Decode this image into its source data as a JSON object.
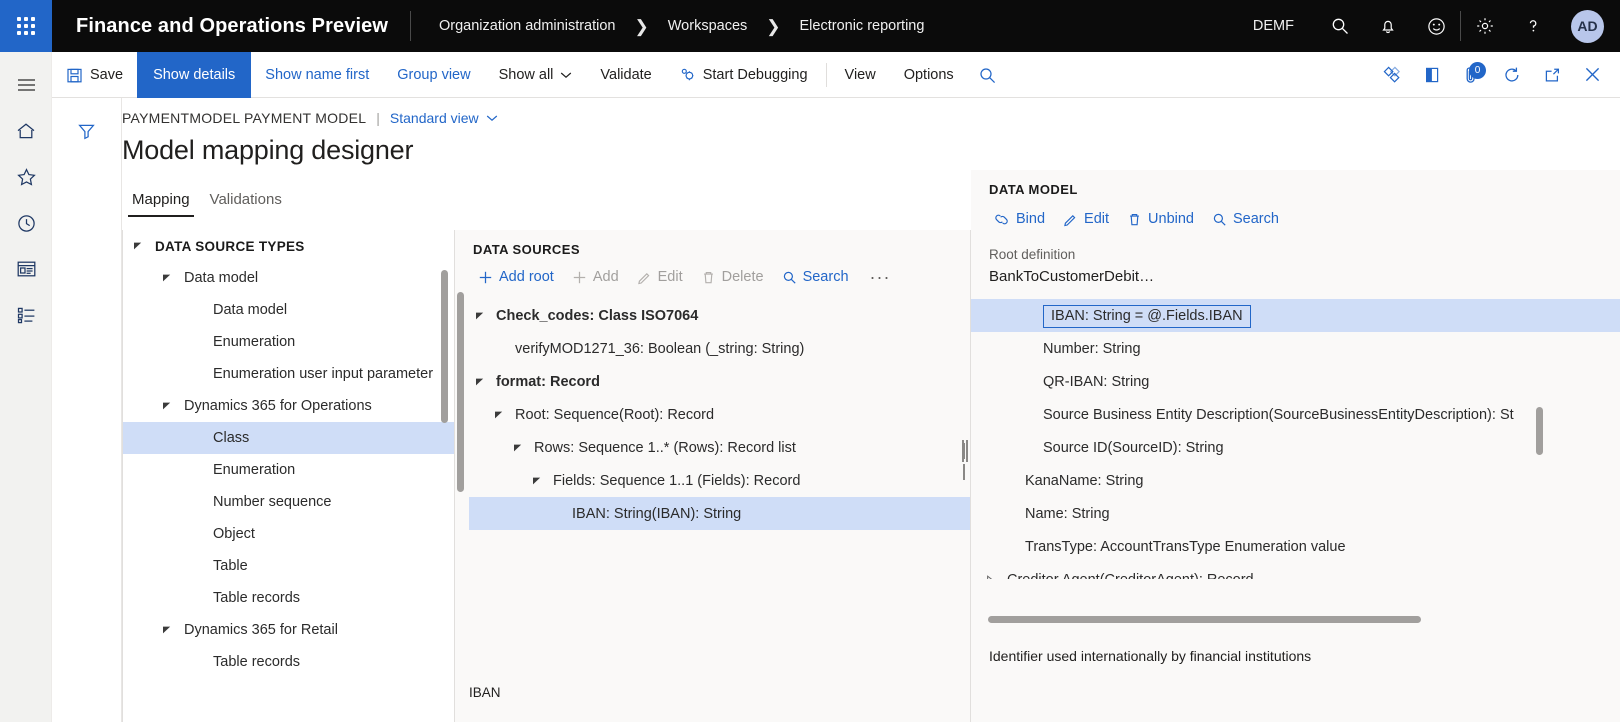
{
  "topbar": {
    "waffle_label": "App launcher",
    "brand": "Finance and Operations Preview",
    "breadcrumb": [
      "Organization administration",
      "Workspaces",
      "Electronic reporting"
    ],
    "company": "DEMF",
    "icons": [
      "search-icon",
      "bell-icon",
      "smiley-icon",
      "gear-icon",
      "help-icon"
    ],
    "avatar_initials": "AD"
  },
  "rail": {
    "items": [
      "hamburger-icon",
      "home-icon",
      "star-icon",
      "clock-icon",
      "workspace-icon",
      "module-list-icon"
    ]
  },
  "actionpane": {
    "save_label": "Save",
    "tabs": [
      {
        "label": "Show details",
        "selected": true
      },
      {
        "label": "Show name first",
        "selected": false
      },
      {
        "label": "Group view",
        "selected": false
      },
      {
        "label": "Show all",
        "selected": false,
        "caret": true
      },
      {
        "label": "Validate",
        "selected": false
      },
      {
        "label": "Start Debugging",
        "selected": false,
        "icon": "debug-icon"
      }
    ],
    "right_menus": [
      "View",
      "Options"
    ],
    "search_icon": "search-icon",
    "right_icons": [
      "diamond-icon",
      "open-in-icon",
      "attachment-icon",
      "refresh-icon",
      "popout-icon",
      "close-icon"
    ],
    "attachment_badge": "0"
  },
  "filter": {
    "icon": "filter-icon"
  },
  "pagehead": {
    "caption": "PAYMENTMODEL PAYMENT MODEL",
    "separator": "|",
    "view": "Standard view",
    "title": "Model mapping designer"
  },
  "tabs": [
    {
      "label": "Mapping",
      "active": true
    },
    {
      "label": "Validations",
      "active": false
    }
  ],
  "panel_types": {
    "title": "DATA SOURCE TYPES",
    "rows": [
      {
        "label": "DATA SOURCE TYPES",
        "indent": 0,
        "toggle": "expanded",
        "header": true,
        "selected": false
      },
      {
        "label": "Data model",
        "indent": 1,
        "toggle": "expanded",
        "header": false,
        "selected": false
      },
      {
        "label": "Data model",
        "indent": 2,
        "toggle": "none",
        "header": false,
        "selected": false
      },
      {
        "label": "Enumeration",
        "indent": 2,
        "toggle": "none",
        "header": false,
        "selected": false
      },
      {
        "label": "Enumeration user input parameter",
        "indent": 2,
        "toggle": "none",
        "header": false,
        "selected": false
      },
      {
        "label": "Dynamics 365 for Operations",
        "indent": 1,
        "toggle": "expanded",
        "header": false,
        "selected": false
      },
      {
        "label": "Class",
        "indent": 2,
        "toggle": "none",
        "header": false,
        "selected": true
      },
      {
        "label": "Enumeration",
        "indent": 2,
        "toggle": "none",
        "header": false,
        "selected": false
      },
      {
        "label": "Number sequence",
        "indent": 2,
        "toggle": "none",
        "header": false,
        "selected": false
      },
      {
        "label": "Object",
        "indent": 2,
        "toggle": "none",
        "header": false,
        "selected": false
      },
      {
        "label": "Table",
        "indent": 2,
        "toggle": "none",
        "header": false,
        "selected": false
      },
      {
        "label": "Table records",
        "indent": 2,
        "toggle": "none",
        "header": false,
        "selected": false
      },
      {
        "label": "Dynamics 365 for Retail",
        "indent": 1,
        "toggle": "expanded",
        "header": false,
        "selected": false
      },
      {
        "label": "Table records",
        "indent": 2,
        "toggle": "none",
        "header": false,
        "selected": false
      }
    ]
  },
  "panel_sources": {
    "title": "DATA SOURCES",
    "toolbar": [
      {
        "label": "Add root",
        "icon": "plus-icon",
        "disabled": false
      },
      {
        "label": "Add",
        "icon": "plus-icon",
        "disabled": true
      },
      {
        "label": "Edit",
        "icon": "pencil-icon",
        "disabled": true
      },
      {
        "label": "Delete",
        "icon": "trash-icon",
        "disabled": true
      },
      {
        "label": "Search",
        "icon": "search-icon",
        "disabled": false
      }
    ],
    "overflow": "···",
    "rows": [
      {
        "label": "Check_codes: Class ISO7064",
        "indent": 0,
        "toggle": "expanded",
        "bold": true,
        "selected": false
      },
      {
        "label": "verifyMOD1271_36: Boolean (_string: String)",
        "indent": 1,
        "toggle": "none",
        "bold": false,
        "selected": false
      },
      {
        "label": "format: Record",
        "indent": 0,
        "toggle": "expanded",
        "bold": true,
        "selected": false
      },
      {
        "label": "Root: Sequence(Root): Record",
        "indent": 1,
        "toggle": "expanded",
        "bold": false,
        "selected": false
      },
      {
        "label": "Rows: Sequence 1..* (Rows): Record list",
        "indent": 2,
        "toggle": "expanded",
        "bold": false,
        "selected": false
      },
      {
        "label": "Fields: Sequence 1..1 (Fields): Record",
        "indent": 3,
        "toggle": "expanded",
        "bold": false,
        "selected": false
      },
      {
        "label": "IBAN: String(IBAN): String",
        "indent": 4,
        "toggle": "none",
        "bold": false,
        "selected": true
      }
    ],
    "footer": "IBAN"
  },
  "panel_model": {
    "title": "DATA MODEL",
    "toolbar": [
      {
        "label": "Bind",
        "icon": "bind-icon"
      },
      {
        "label": "Edit",
        "icon": "pencil-icon"
      },
      {
        "label": "Unbind",
        "icon": "trash-icon"
      },
      {
        "label": "Search",
        "icon": "search-icon"
      }
    ],
    "root_definition_label": "Root definition",
    "root_definition_value": "BankToCustomerDebit…",
    "rows": [
      {
        "label": "IBAN: String = @.Fields.IBAN",
        "indent": 2,
        "toggle": "none",
        "selected": true,
        "chip": true
      },
      {
        "label": "Number: String",
        "indent": 2,
        "toggle": "none",
        "selected": false,
        "chip": false
      },
      {
        "label": "QR-IBAN: String",
        "indent": 2,
        "toggle": "none",
        "selected": false,
        "chip": false
      },
      {
        "label": "Source Business Entity Description(SourceBusinessEntityDescription): St",
        "indent": 2,
        "toggle": "none",
        "selected": false,
        "chip": false
      },
      {
        "label": "Source ID(SourceID): String",
        "indent": 2,
        "toggle": "none",
        "selected": false,
        "chip": false
      },
      {
        "label": "KanaName: String",
        "indent": 1,
        "toggle": "none",
        "selected": false,
        "chip": false
      },
      {
        "label": "Name: String",
        "indent": 1,
        "toggle": "none",
        "selected": false,
        "chip": false
      },
      {
        "label": "TransType: AccountTransType Enumeration value",
        "indent": 1,
        "toggle": "none",
        "selected": false,
        "chip": false
      },
      {
        "label": "Creditor Agent(CreditorAgent): Record",
        "indent": 0,
        "toggle": "collapsed",
        "selected": false,
        "chip": false
      }
    ],
    "description": "Identifier used internationally by financial institutions"
  },
  "colors": {
    "accent": "#2266c8",
    "topbar_bg": "#0b0b0b",
    "selection_bg": "#cfddf7",
    "panel_bg": "#faf9f8",
    "link": "#2266c8",
    "disabled": "#a19f9d"
  }
}
